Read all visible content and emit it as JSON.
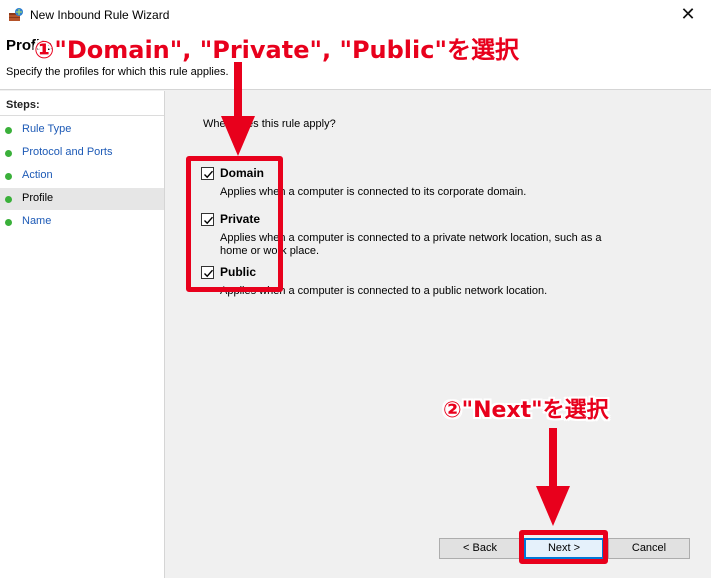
{
  "window": {
    "title": "New Inbound Rule Wizard",
    "close_glyph": "✕"
  },
  "header": {
    "title": "Profile",
    "description": "Specify the profiles for which this rule applies."
  },
  "steps": {
    "heading": "Steps:",
    "items": [
      {
        "label": "Rule Type"
      },
      {
        "label": "Protocol and Ports"
      },
      {
        "label": "Action"
      },
      {
        "label": "Profile",
        "current": true
      },
      {
        "label": "Name"
      }
    ]
  },
  "main": {
    "question": "When does this rule apply?",
    "options": [
      {
        "name": "Domain",
        "checked": true,
        "description": "Applies when a computer is connected to its corporate domain."
      },
      {
        "name": "Private",
        "checked": true,
        "description": "Applies when a computer is connected to a private network location, such as a home or work place."
      },
      {
        "name": "Public",
        "checked": true,
        "description": "Applies when a computer is connected to a public network location."
      }
    ]
  },
  "buttons": {
    "back": "< Back",
    "next": "Next >",
    "cancel": "Cancel"
  },
  "annotations": {
    "step1": "①\"Domain\", \"Private\", \"Public\"を選択",
    "step2": "②\"Next\"を選択",
    "highlight_color": "#e8001c"
  }
}
